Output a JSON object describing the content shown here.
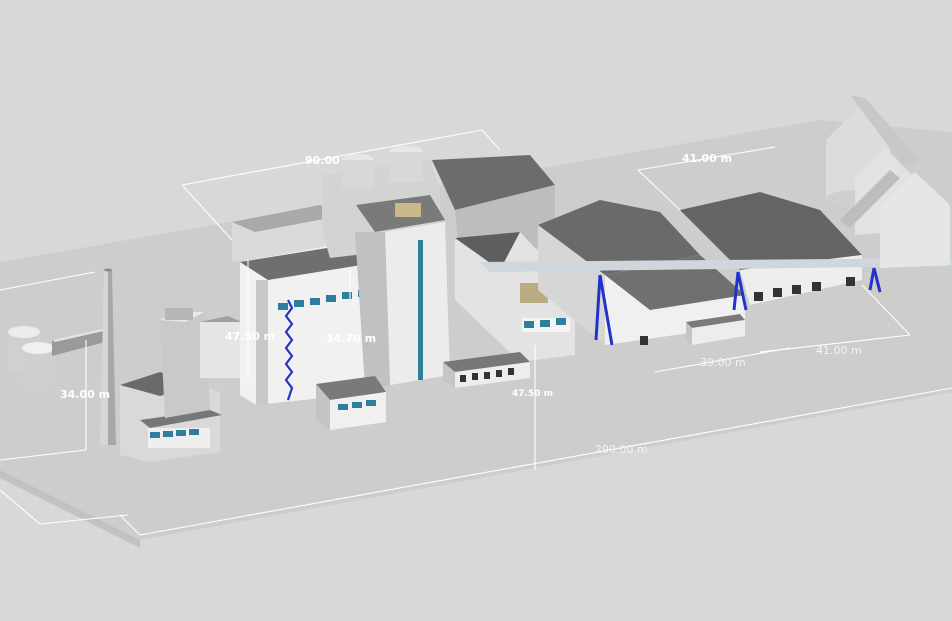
{
  "scene": {
    "description_free": true,
    "colors": {
      "background": "#d8d8d6",
      "ground": "#cacac8",
      "roof_dark": "#5c5c5c",
      "wall_light": "#e6e6e6",
      "wall_mid": "#bcbcbc",
      "window": "#2f7f9c",
      "steel_blue": "#2233cc",
      "dimension": "#ffffff"
    }
  },
  "dimensions": {
    "top_width": "90.00",
    "warehouse_top": "41.00 m",
    "chimney_height": "34.00 m",
    "boiler_height": "47.50 m",
    "tower_height": "34.70 m",
    "mid_height": "47.50 m",
    "warehouse_span": "39.00 m",
    "warehouse_right": "41.00 m",
    "total_length": "290.00 m"
  }
}
